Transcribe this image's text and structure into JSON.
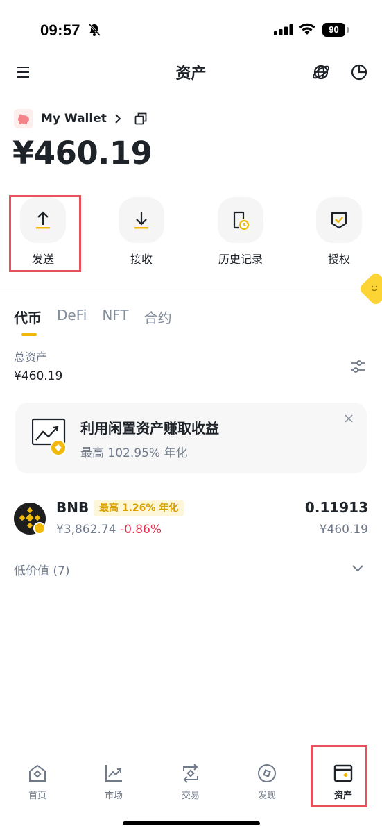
{
  "status_bar": {
    "time": "09:57",
    "battery": "90"
  },
  "header": {
    "title": "资产"
  },
  "wallet": {
    "name": "My Wallet",
    "total_balance": "¥460.19"
  },
  "actions": [
    {
      "label": "发送",
      "icon": "arrow-up-icon"
    },
    {
      "label": "接收",
      "icon": "arrow-down-icon"
    },
    {
      "label": "历史记录",
      "icon": "history-icon"
    },
    {
      "label": "授权",
      "icon": "approval-icon"
    }
  ],
  "tabs": [
    {
      "label": "代币",
      "active": true
    },
    {
      "label": "DeFi",
      "active": false
    },
    {
      "label": "NFT",
      "active": false
    },
    {
      "label": "合约",
      "active": false
    }
  ],
  "assets": {
    "label": "总资产",
    "value": "¥460.19"
  },
  "promo": {
    "title": "利用闲置资产赚取收益",
    "subtitle": "最高 102.95% 年化"
  },
  "tokens": [
    {
      "symbol": "BNB",
      "apy_badge": "最高 1.26% 年化",
      "price": "¥3,862.74",
      "change": "-0.86%",
      "amount": "0.11913",
      "fiat_value": "¥460.19"
    }
  ],
  "low_value": {
    "label": "低价值 (7)"
  },
  "bottom_nav": [
    {
      "label": "首页",
      "icon": "home-icon",
      "active": false
    },
    {
      "label": "市场",
      "icon": "market-chart-icon",
      "active": false
    },
    {
      "label": "交易",
      "icon": "trade-icon",
      "active": false
    },
    {
      "label": "发现",
      "icon": "discover-icon",
      "active": false
    },
    {
      "label": "资产",
      "icon": "wallet-icon",
      "active": true
    }
  ],
  "colors": {
    "accent": "#f0b90b",
    "negative": "#e0304e",
    "highlight": "#e8505b",
    "text": "#1e2329",
    "muted": "#707a8a"
  }
}
